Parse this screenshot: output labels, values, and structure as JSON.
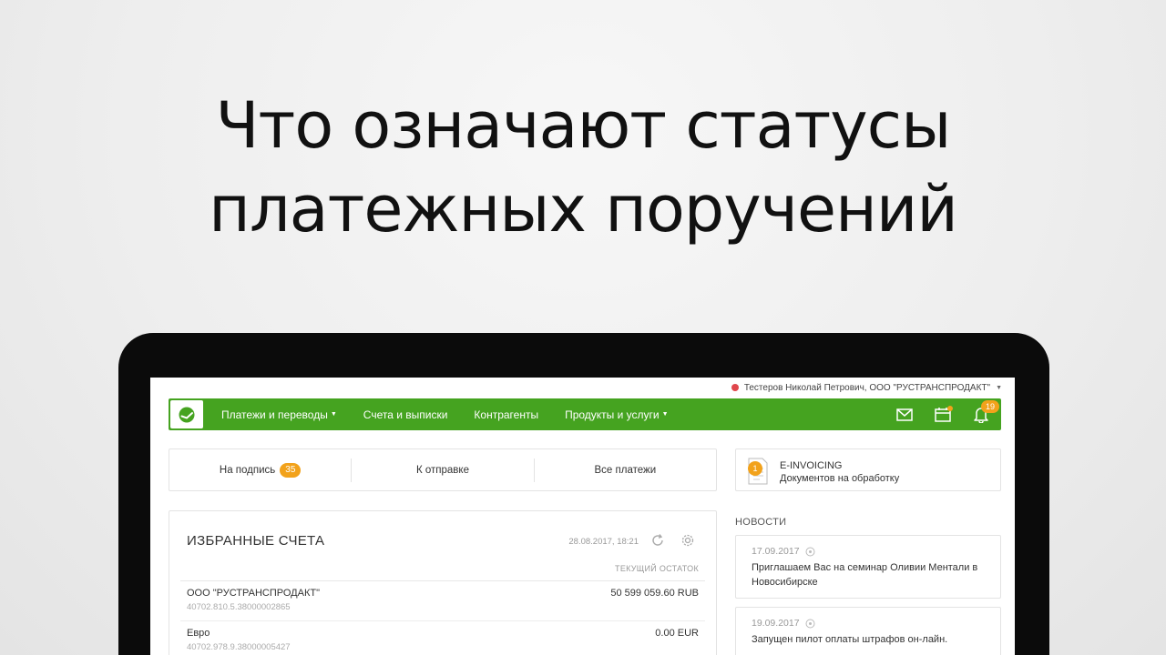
{
  "headline": {
    "line1": "Что означают статусы",
    "line2": "платежных поручений"
  },
  "colors": {
    "brand_green": "#45a320",
    "accent_orange": "#f2a21b",
    "status_red": "#e0474c"
  },
  "user": {
    "name": "Тестеров Николай Петрович, ООО \"РУСТРАНСПРОДАКТ\""
  },
  "nav": {
    "items": [
      {
        "label": "Платежи и переводы",
        "has_dropdown": true
      },
      {
        "label": "Счета и выписки",
        "has_dropdown": false
      },
      {
        "label": "Контрагенты",
        "has_dropdown": false
      },
      {
        "label": "Продукты и услуги",
        "has_dropdown": true
      }
    ],
    "icons": [
      "mail-icon",
      "calendar-icon",
      "bell-icon"
    ],
    "notifications_count": "19"
  },
  "tabs": [
    {
      "label": "На подпись",
      "badge": "35"
    },
    {
      "label": "К отправке"
    },
    {
      "label": "Все платежи"
    }
  ],
  "einvoicing": {
    "badge": "1",
    "title": "E-INVOICING",
    "subtitle": "Документов на обработку"
  },
  "favorites": {
    "title": "ИЗБРАННЫЕ СЧЕТА",
    "updated": "28.08.2017, 18:21",
    "column_header": "ТЕКУЩИЙ ОСТАТОК",
    "accounts": [
      {
        "name": "ООО \"РУСТРАНСПРОДАКТ\"",
        "number": "40702.810.5.38000002865",
        "balance": "50 599 059.60 RUB"
      },
      {
        "name": "Евро",
        "number": "40702.978.9.38000005427",
        "balance": "0.00 EUR"
      }
    ]
  },
  "news": {
    "title": "НОВОСТИ",
    "items": [
      {
        "date": "17.09.2017",
        "text": "Приглашаем Вас на семинар Оливии Ментали в Новосибирске"
      },
      {
        "date": "19.09.2017",
        "text": "Запущен пилот оплаты штрафов он-лайн."
      }
    ]
  }
}
